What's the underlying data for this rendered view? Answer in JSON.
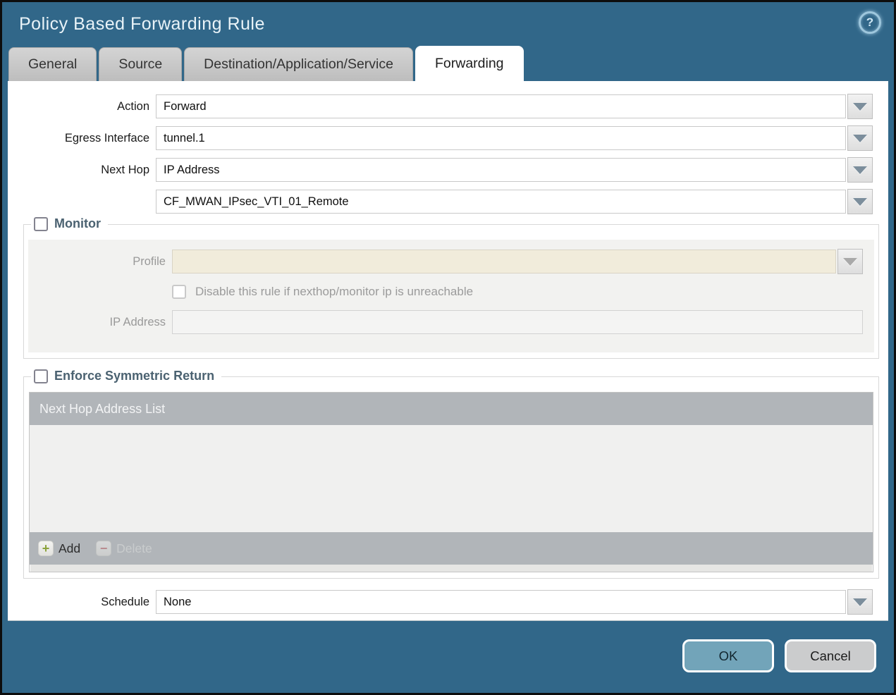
{
  "window": {
    "title": "Policy Based Forwarding Rule",
    "help_glyph": "?"
  },
  "tabs": [
    {
      "label": "General",
      "active": false
    },
    {
      "label": "Source",
      "active": false
    },
    {
      "label": "Destination/Application/Service",
      "active": false
    },
    {
      "label": "Forwarding",
      "active": true
    }
  ],
  "form": {
    "action": {
      "label": "Action",
      "value": "Forward"
    },
    "egress_interface": {
      "label": "Egress Interface",
      "value": "tunnel.1"
    },
    "next_hop": {
      "label": "Next Hop",
      "value": "IP Address"
    },
    "next_hop_address": {
      "value": "CF_MWAN_IPsec_VTI_01_Remote"
    },
    "schedule": {
      "label": "Schedule",
      "value": "None"
    }
  },
  "monitor": {
    "legend": "Monitor",
    "checked": false,
    "profile": {
      "label": "Profile",
      "value": ""
    },
    "disable_rule": {
      "label": "Disable this rule if nexthop/monitor ip is unreachable",
      "checked": false
    },
    "ip_address": {
      "label": "IP Address",
      "value": ""
    }
  },
  "enforce_symmetric_return": {
    "legend": "Enforce Symmetric Return",
    "checked": false,
    "table": {
      "header": "Next Hop Address List",
      "rows": [],
      "add_label": "Add",
      "add_glyph": "+",
      "delete_label": "Delete",
      "delete_glyph": "−",
      "delete_enabled": false
    }
  },
  "footer": {
    "ok_label": "OK",
    "cancel_label": "Cancel"
  },
  "colors": {
    "titlebar_background": "#316789",
    "active_tab_background": "#ffffff",
    "inactive_tab_background": "#c6c6c6",
    "fieldset_legend_text": "#4b6271",
    "disabled_field_background": "#f1ecdb",
    "table_chrome_gray": "#b1b5b9",
    "ok_button_background": "#72a4b9",
    "cancel_button_background": "#cbcccd",
    "add_icon_green": "#8ba33b",
    "delete_icon_red": "#c06a6e"
  }
}
